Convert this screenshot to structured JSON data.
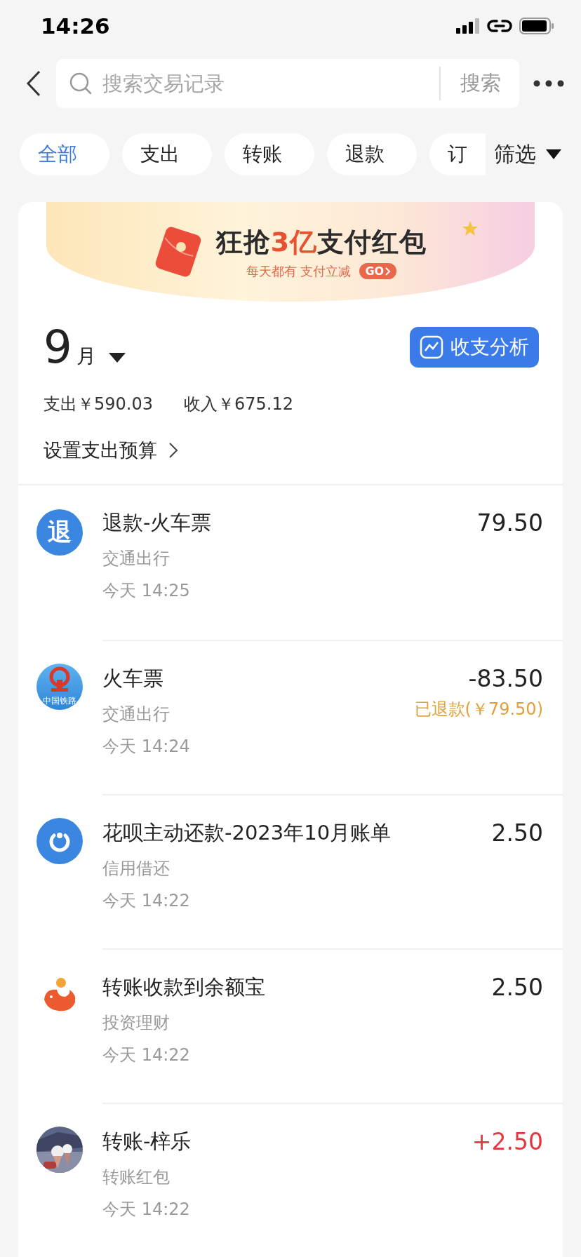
{
  "status_bar": {
    "time": "14:26"
  },
  "search": {
    "placeholder": "搜索交易记录",
    "button": "搜索"
  },
  "filters": [
    {
      "label": "全部",
      "selected": true
    },
    {
      "label": "支出",
      "selected": false
    },
    {
      "label": "转账",
      "selected": false
    },
    {
      "label": "退款",
      "selected": false
    },
    {
      "label": "订",
      "selected": false
    }
  ],
  "filter_menu": "筛选",
  "banner": {
    "title": "狂抢**3亿**支付红包",
    "subtitle": "每天都有 支付立减",
    "go": "GO"
  },
  "month": {
    "number": "9",
    "unit": "月",
    "analysis_button": "收支分析",
    "expense": "支出￥590.03",
    "income": "收入￥675.12",
    "budget_link": "设置支出预算"
  },
  "transactions": [
    {
      "kind": "refund",
      "icon_text": "退",
      "title": "退款-火车票",
      "category": "交通出行",
      "time": "今天 14:25",
      "amount": "79.50",
      "income": false
    },
    {
      "kind": "railway",
      "icon_text": "中国铁路",
      "title": "火车票",
      "category": "交通出行",
      "time": "今天 14:24",
      "amount": "-83.50",
      "income": false,
      "note": "已退款(￥79.50)"
    },
    {
      "kind": "credit",
      "title": "花呗主动还款-2023年10月账单",
      "category": "信用借还",
      "time": "今天 14:22",
      "amount": "2.50",
      "income": false
    },
    {
      "kind": "savings",
      "title": "转账收款到余额宝",
      "category": "投资理财",
      "time": "今天 14:22",
      "amount": "2.50",
      "income": false
    },
    {
      "title": "转账-梓乐",
      "category": "转账红包",
      "time": "今天 14:22",
      "amount": "+2.50",
      "income": true
    }
  ]
}
